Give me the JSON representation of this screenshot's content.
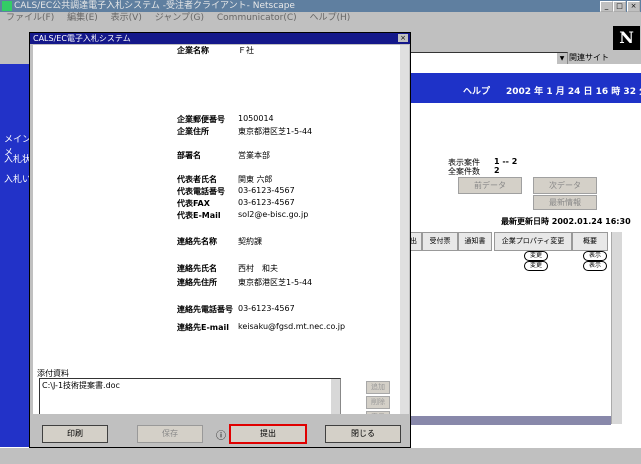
{
  "window": {
    "title": "CALS/EC公共調達電子入札システム -受注者クライアント- Netscape",
    "controls": [
      "_",
      "□",
      "×"
    ]
  },
  "menubar": [
    "ファイル(F)",
    "編集(E)",
    "表示(V)",
    "ジャンプ(G)",
    "Communicator(C)",
    "ヘルプ(H)"
  ],
  "toolbar": {
    "related_sites": "関連サイト",
    "logo_letter": "N"
  },
  "leftnav": [
    "メインメ",
    "入札状",
    "入札い"
  ],
  "header": {
    "help": "ヘルプ",
    "date": "2002 年 1 月 24 日 16 時 32 分"
  },
  "summary": {
    "shown_label": "表示案件",
    "shown_value": "1 -- 2",
    "total_label": "全案件数",
    "total_value": "2",
    "prev_button": "前データ",
    "next_button": "次データ",
    "refresh_button": "最新情報",
    "updated": "最新更新日時 2002.01.24 16:30"
  },
  "table": {
    "headers": [
      "提出",
      "受付票",
      "通知書",
      "企業プロパティ変更",
      "概要"
    ],
    "rows": [
      {
        "property": "変更",
        "summary": "表示"
      },
      {
        "property": "変更",
        "summary": "表示"
      }
    ]
  },
  "dialog": {
    "title": "CALS/EC電子入札システム",
    "close": "×",
    "fields": [
      {
        "label": "企業名称",
        "value": "Ｆ社"
      },
      {
        "label": "企業郵便番号",
        "value": "1050014"
      },
      {
        "label": "企業住所",
        "value": "東京都港区芝1-5-44"
      },
      {
        "label": "部署名",
        "value": "営業本部"
      },
      {
        "label": "代表者氏名",
        "value": "関東 六郎"
      },
      {
        "label": "代表電話番号",
        "value": "03-6123-4567"
      },
      {
        "label": "代表FAX",
        "value": "03-6123-4567"
      },
      {
        "label": "代表E-Mail",
        "value": "sol2@e-bisc.go.jp"
      },
      {
        "label": "連絡先名称",
        "value": "契約課"
      },
      {
        "label": "連絡先氏名",
        "value": "西村　和夫"
      },
      {
        "label": "連絡先住所",
        "value": "東京都港区芝1-5-44"
      },
      {
        "label": "連絡先電話番号",
        "value": "03-6123-4567"
      },
      {
        "label": "連絡先E-mail",
        "value": "keisaku@fgsd.mt.nec.co.jp"
      }
    ],
    "attachments": {
      "label": "添付資料",
      "files": [
        "C:\\J-1技術提案書.doc"
      ],
      "add_button": "追加",
      "delete_button": "削除",
      "view_button": "表示"
    },
    "buttons": {
      "print": "印刷",
      "save": "保存",
      "info_icon": "ⓘ",
      "submit": "提出",
      "close": "閉じる"
    }
  }
}
